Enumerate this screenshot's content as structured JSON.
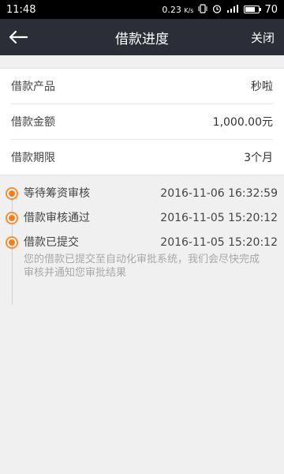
{
  "status_bar": {
    "time": "11:48",
    "net_speed": "0.23",
    "net_speed_unit": "K/s",
    "battery": "70",
    "icons": [
      "vibrate-icon",
      "alarm-icon",
      "signal-icon",
      "battery-icon"
    ]
  },
  "nav": {
    "back_icon": "back-arrow-icon",
    "title": "借款进度",
    "close_label": "关闭"
  },
  "loan_info": [
    {
      "label": "借款产品",
      "value": "秒啦"
    },
    {
      "label": "借款金额",
      "value": "1,000.00元"
    },
    {
      "label": "借款期限",
      "value": "3个月"
    }
  ],
  "timeline": [
    {
      "title": "等待筹资审核",
      "time": "2016-11-06 16:32:59",
      "desc": ""
    },
    {
      "title": "借款审核通过",
      "time": "2016-11-05 15:20:12",
      "desc": ""
    },
    {
      "title": "借款已提交",
      "time": "2016-11-05 15:20:12",
      "desc": "您的借款已提交至自动化审批系统，我们会尽快完成审核并通知您审批结果"
    }
  ],
  "colors": {
    "nav_bg": "#2b2e36",
    "accent": "#ff7b18",
    "page_bg": "#f0f0f0"
  }
}
